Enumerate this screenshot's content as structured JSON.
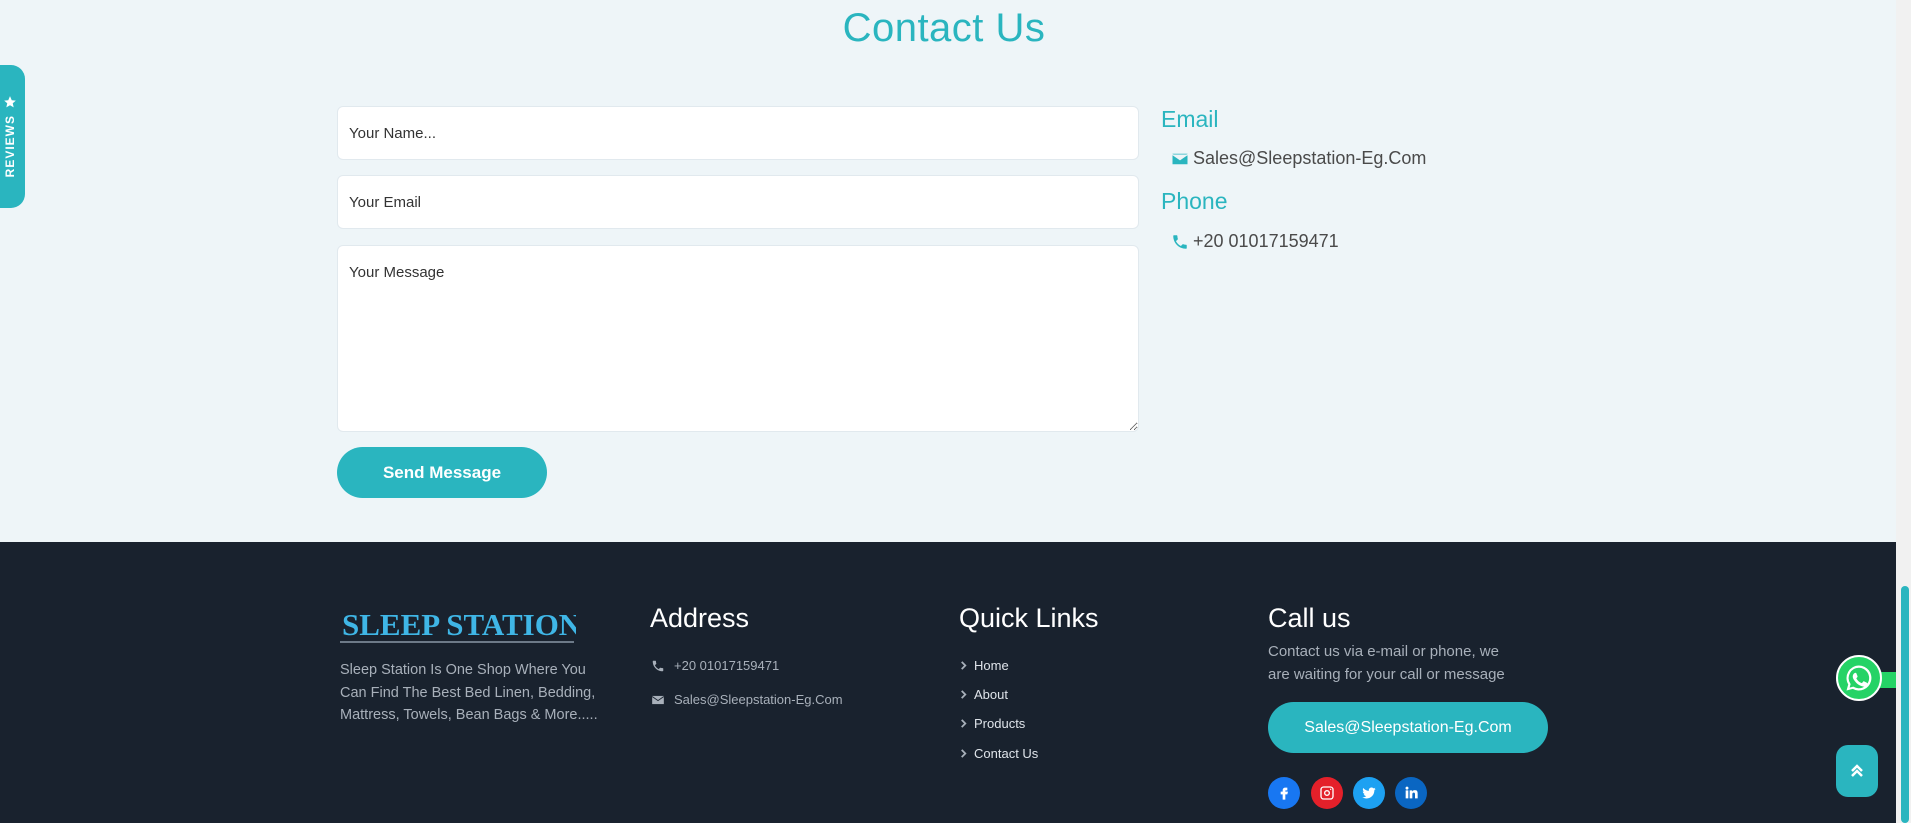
{
  "contact": {
    "title": "Contact Us",
    "name_placeholder": "Your Name...",
    "email_placeholder": "Your Email",
    "message_placeholder": "Your Message",
    "send_label": "Send Message",
    "email_heading": "Email",
    "email_value": "Sales@Sleepstation-Eg.Com",
    "phone_heading": "Phone",
    "phone_value": "+20 01017159471"
  },
  "reviews_tab": {
    "label": "REVIEWS",
    "icon": "star-icon"
  },
  "footer": {
    "logo_text": "SLEEP STATION",
    "about": "Sleep Station Is One Shop Where You Can Find The Best Bed Linen, Bedding, Mattress, Towels, Bean Bags & More.....",
    "address": {
      "heading": "Address",
      "phone": "+20 01017159471",
      "email": "Sales@Sleepstation-Eg.Com"
    },
    "quick_links": {
      "heading": "Quick Links",
      "items": [
        "Home",
        "About",
        "Products",
        "Contact Us"
      ]
    },
    "call_us": {
      "heading": "Call us",
      "text": "Contact us via e-mail or phone, we are waiting for your call or message",
      "button": "Sales@Sleepstation-Eg.Com"
    },
    "social": [
      {
        "name": "facebook-icon",
        "color": "#1877f2"
      },
      {
        "name": "instagram-icon",
        "color": "#e4202a"
      },
      {
        "name": "twitter-icon",
        "color": "#1da1f2"
      },
      {
        "name": "linkedin-icon",
        "color": "#0a66c2"
      }
    ]
  },
  "colors": {
    "accent": "#2ab5bf",
    "footer_bg": "#19222e",
    "page_bg": "#eef5f8"
  }
}
